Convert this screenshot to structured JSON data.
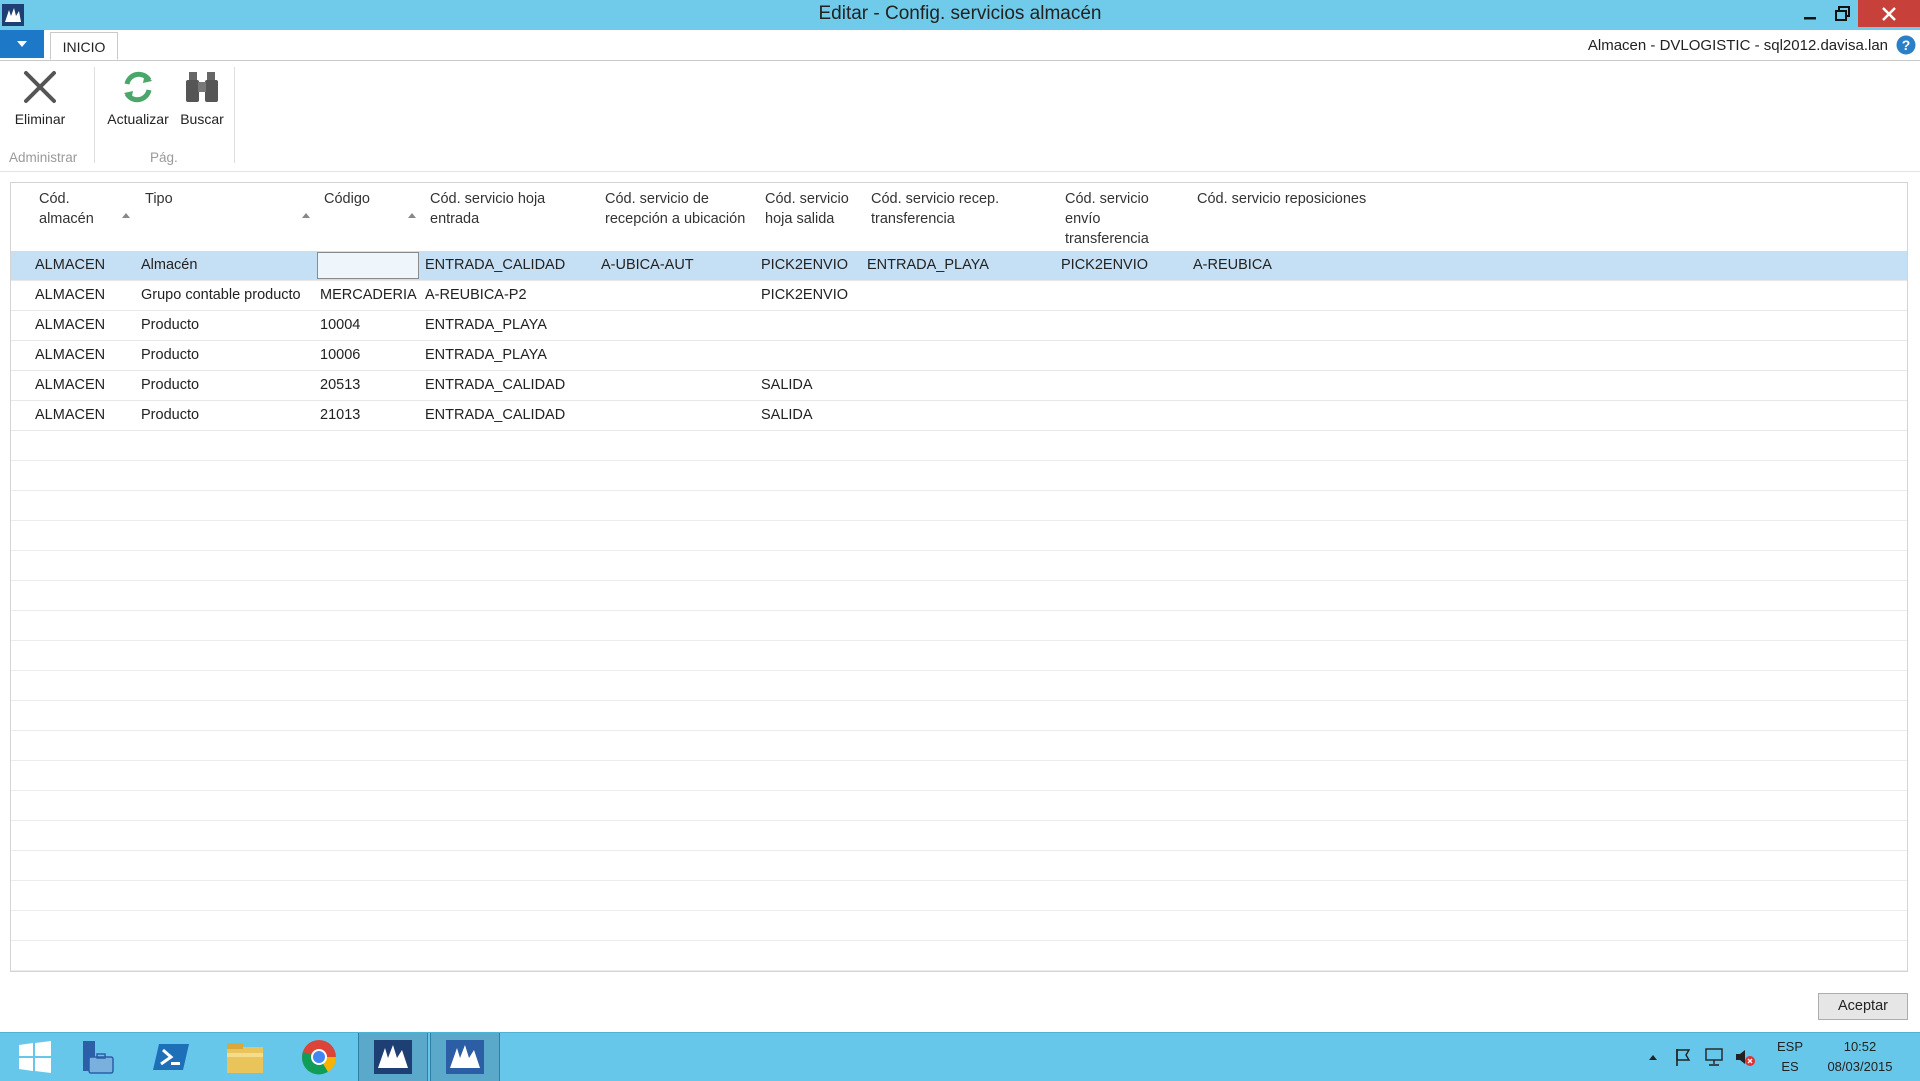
{
  "window": {
    "title": "Editar - Config. servicios almacén",
    "context": "Almacen - DVLOGISTIC - sql2012.davisa.lan"
  },
  "ribbon": {
    "tab_inicio": "INICIO",
    "eliminar": "Eliminar",
    "actualizar": "Actualizar",
    "buscar": "Buscar",
    "group_administrar": "Administrar",
    "group_pag": "Pág."
  },
  "grid": {
    "headers": {
      "cod_almacen": "Cód.\nalmacén",
      "tipo": "Tipo",
      "codigo": "Código",
      "hoja_entrada": "Cód. servicio hoja\nentrada",
      "recepcion_ubicacion": "Cód. servicio de\nrecepción a ubicación",
      "hoja_salida": "Cód. servicio\nhoja salida",
      "recep_transferencia": "Cód. servicio recep.\ntransferencia",
      "envio_transferencia": "Cód. servicio\nenvío\ntransferencia",
      "reposiciones": "Cód. servicio reposiciones"
    },
    "rows": [
      {
        "cod_almacen": "ALMACEN",
        "tipo": "Almacén",
        "codigo": "",
        "hoja_entrada": "ENTRADA_CALIDAD",
        "recepcion_ubicacion": "A-UBICA-AUT",
        "hoja_salida": "PICK2ENVIO",
        "recep_transferencia": "ENTRADA_PLAYA",
        "envio_transferencia": "PICK2ENVIO",
        "reposiciones": "A-REUBICA"
      },
      {
        "cod_almacen": "ALMACEN",
        "tipo": "Grupo contable producto",
        "codigo": "MERCADERIA",
        "hoja_entrada": "A-REUBICA-P2",
        "recepcion_ubicacion": "",
        "hoja_salida": "PICK2ENVIO",
        "recep_transferencia": "",
        "envio_transferencia": "",
        "reposiciones": ""
      },
      {
        "cod_almacen": "ALMACEN",
        "tipo": "Producto",
        "codigo": "10004",
        "hoja_entrada": "ENTRADA_PLAYA",
        "recepcion_ubicacion": "",
        "hoja_salida": "",
        "recep_transferencia": "",
        "envio_transferencia": "",
        "reposiciones": ""
      },
      {
        "cod_almacen": "ALMACEN",
        "tipo": "Producto",
        "codigo": "10006",
        "hoja_entrada": "ENTRADA_PLAYA",
        "recepcion_ubicacion": "",
        "hoja_salida": "",
        "recep_transferencia": "",
        "envio_transferencia": "",
        "reposiciones": ""
      },
      {
        "cod_almacen": "ALMACEN",
        "tipo": "Producto",
        "codigo": "20513",
        "hoja_entrada": "ENTRADA_CALIDAD",
        "recepcion_ubicacion": "",
        "hoja_salida": "SALIDA",
        "recep_transferencia": "",
        "envio_transferencia": "",
        "reposiciones": ""
      },
      {
        "cod_almacen": "ALMACEN",
        "tipo": "Producto",
        "codigo": "21013",
        "hoja_entrada": "ENTRADA_CALIDAD",
        "recepcion_ubicacion": "",
        "hoja_salida": "SALIDA",
        "recep_transferencia": "",
        "envio_transferencia": "",
        "reposiciones": ""
      }
    ]
  },
  "footer": {
    "accept": "Aceptar"
  },
  "taskbar": {
    "lang_top": "ESP",
    "lang_bottom": "ES",
    "time": "10:52",
    "date": "08/03/2015",
    "items": [
      "windows-start-icon",
      "server-manager-icon",
      "powershell-icon",
      "file-explorer-icon",
      "chrome-icon",
      "dynamics-nav-icon",
      "dynamics-nav-icon"
    ]
  },
  "colors": {
    "titlebar": "#6fcbe9",
    "selected_row": "#c5e0f4",
    "taskbar": "#67c7ea",
    "close_button": "#c7403a"
  }
}
